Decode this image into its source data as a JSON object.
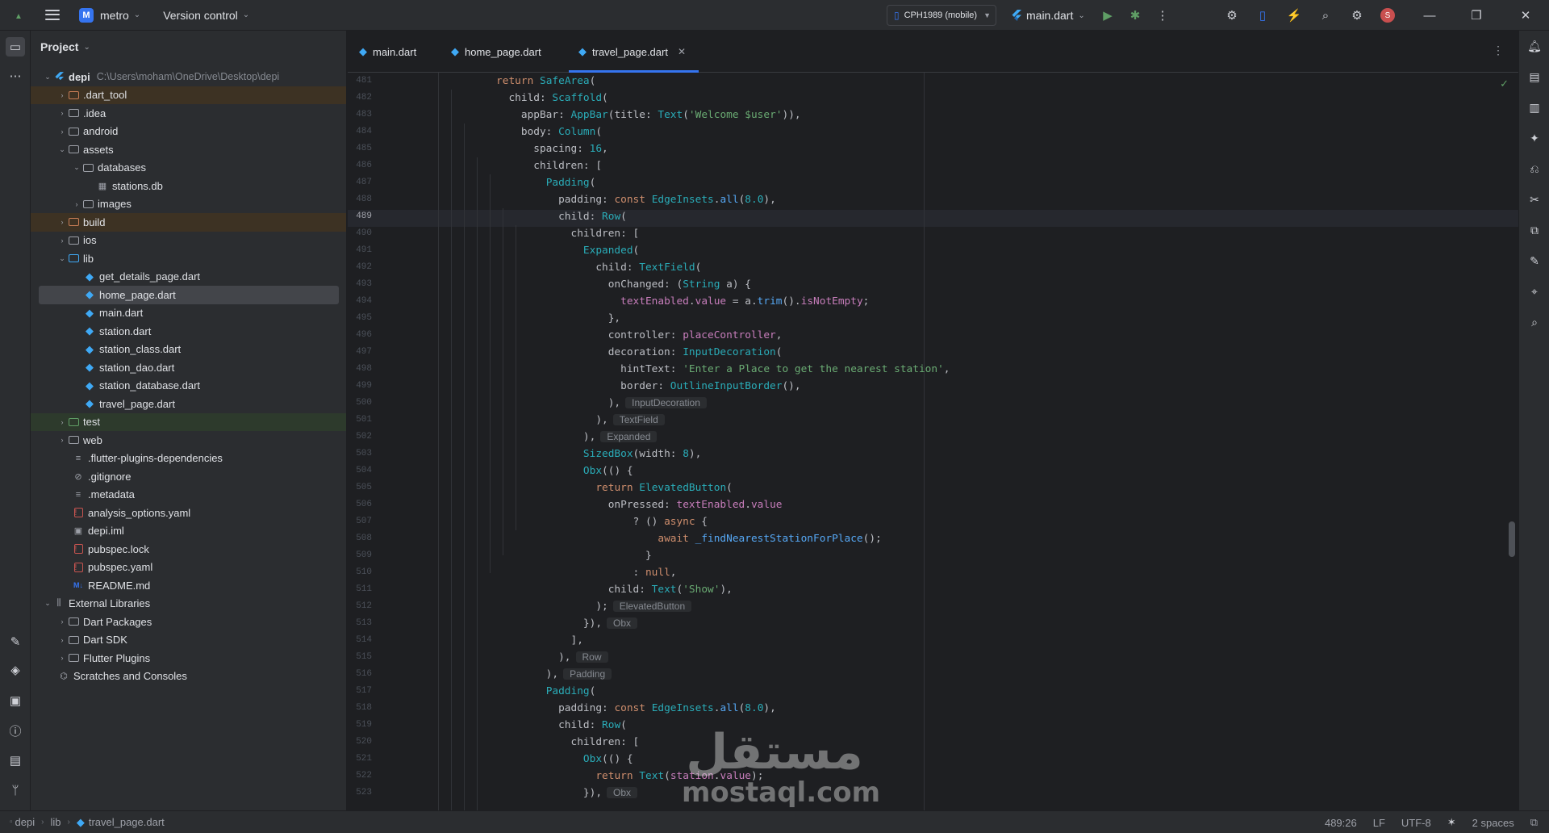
{
  "titlebar": {
    "project_initial": "M",
    "project_name": "metro",
    "version_control": "Version control",
    "device": "CPH1989 (mobile)",
    "run_config": "main.dart",
    "avatar_initial": "S"
  },
  "project_panel": {
    "title": "Project",
    "root_name": "depi",
    "root_path": "C:\\Users\\moham\\OneDrive\\Desktop\\depi",
    "items": [
      {
        "label": ".dart_tool"
      },
      {
        "label": ".idea"
      },
      {
        "label": "android"
      },
      {
        "label": "assets"
      },
      {
        "label": "databases"
      },
      {
        "label": "stations.db"
      },
      {
        "label": "images"
      },
      {
        "label": "build"
      },
      {
        "label": "ios"
      },
      {
        "label": "lib"
      },
      {
        "label": "get_details_page.dart"
      },
      {
        "label": "home_page.dart"
      },
      {
        "label": "main.dart"
      },
      {
        "label": "station.dart"
      },
      {
        "label": "station_class.dart"
      },
      {
        "label": "station_dao.dart"
      },
      {
        "label": "station_database.dart"
      },
      {
        "label": "travel_page.dart"
      },
      {
        "label": "test"
      },
      {
        "label": "web"
      },
      {
        "label": ".flutter-plugins-dependencies"
      },
      {
        "label": ".gitignore"
      },
      {
        "label": ".metadata"
      },
      {
        "label": "analysis_options.yaml"
      },
      {
        "label": "depi.iml"
      },
      {
        "label": "pubspec.lock"
      },
      {
        "label": "pubspec.yaml"
      },
      {
        "label": "README.md"
      },
      {
        "label": "External Libraries"
      },
      {
        "label": "Dart Packages"
      },
      {
        "label": "Dart SDK"
      },
      {
        "label": "Flutter Plugins"
      },
      {
        "label": "Scratches and Consoles"
      }
    ]
  },
  "tabs": [
    {
      "label": "main.dart"
    },
    {
      "label": "home_page.dart"
    },
    {
      "label": "travel_page.dart"
    }
  ],
  "editor": {
    "line_numbers": [
      "481",
      "482",
      "483",
      "484",
      "485",
      "486",
      "487",
      "488",
      "489",
      "490",
      "491",
      "492",
      "493",
      "494",
      "495",
      "496",
      "497",
      "498",
      "499",
      "500",
      "501",
      "502",
      "503",
      "504",
      "505",
      "506",
      "507",
      "508",
      "509",
      "510",
      "511",
      "512",
      "513",
      "514",
      "515",
      "516",
      "517",
      "518",
      "519",
      "520",
      "521",
      "522",
      "523"
    ],
    "hints": {
      "input_decoration": "InputDecoration",
      "text_field": "TextField",
      "expanded": "Expanded",
      "elevated_button": "ElevatedButton",
      "obx": "Obx",
      "row": "Row",
      "padding": "Padding"
    }
  },
  "watermark": {
    "arabic": "مستقل",
    "latin": "mostaql.com"
  },
  "statusbar": {
    "crumbs": [
      "depi",
      "lib",
      "travel_page.dart"
    ],
    "position": "489:26",
    "line_sep": "LF",
    "encoding": "UTF-8",
    "indent": "2 spaces"
  },
  "colors": {
    "accent": "#3574f0",
    "keyword": "#cf8e6d",
    "string": "#6aab73",
    "class": "#2aacb8"
  }
}
